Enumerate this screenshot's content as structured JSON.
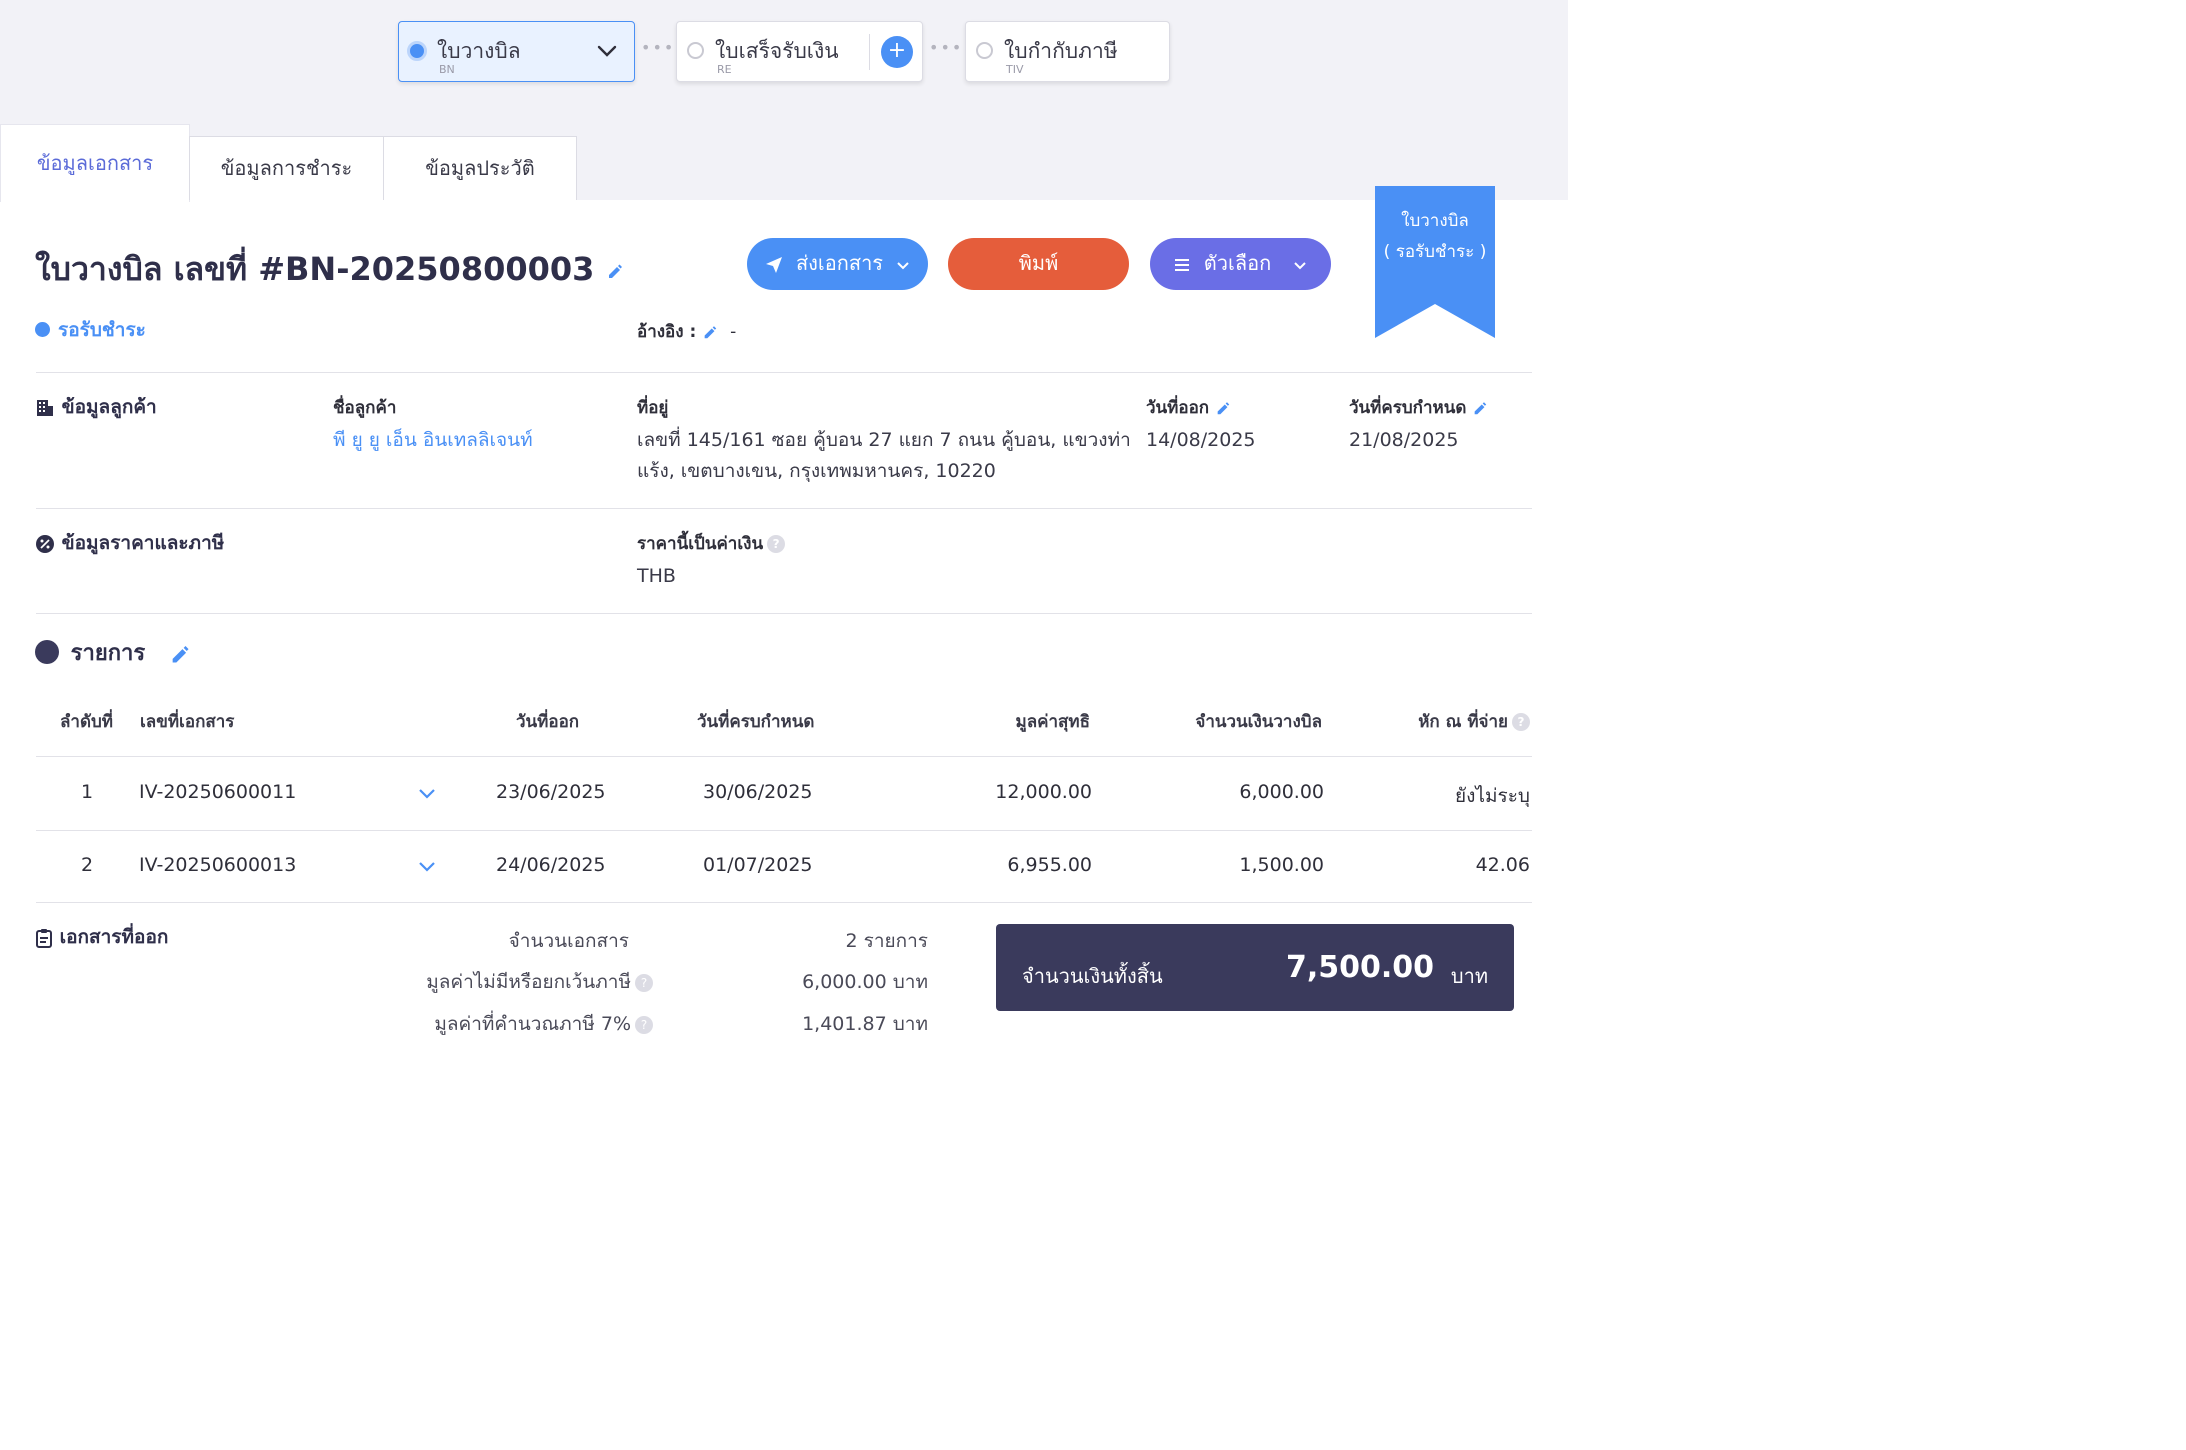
{
  "flow": {
    "billing": {
      "title": "ใบวางบิล",
      "code": "BN"
    },
    "receipt": {
      "title": "ใบเสร็จรับเงิน",
      "code": "RE"
    },
    "tax_invoice": {
      "title": "ใบกำกับภาษี",
      "code": "TIV"
    }
  },
  "tabs": [
    "ข้อมูลเอกสาร",
    "ข้อมูลการชำระ",
    "ข้อมูลประวัติ"
  ],
  "ribbon": {
    "line1": "ใบวางบิล",
    "line2": "( รอรับชำระ )"
  },
  "document": {
    "title": "ใบวางบิล เลขที่ #BN-20250800003",
    "status": "รอรับชำระ",
    "reference_label": "อ้างอิง :",
    "reference_value": "-"
  },
  "buttons": {
    "send": "ส่งเอกสาร",
    "print": "พิมพ์",
    "options": "ตัวเลือก"
  },
  "customer": {
    "section_label": "ข้อมูลลูกค้า",
    "name_label": "ชื่อลูกค้า",
    "name": "พี ยู ยู เอ็น อินเทลลิเจนท์",
    "address_label": "ที่อยู่",
    "address_line1": "เลขที่ 145/161 ซอย คู้บอน 27 แยก 7 ถนน คู้บอน, แขวงท่า",
    "address_line2": "แร้ง, เขตบางเขน, กรุงเทพมหานคร, 10220",
    "issue_date_label": "วันที่ออก",
    "issue_date": "14/08/2025",
    "due_date_label": "วันที่ครบกำหนด",
    "due_date": "21/08/2025"
  },
  "pricing": {
    "section_label": "ข้อมูลราคาและภาษี",
    "currency_label": "ราคานี้เป็นค่าเงิน",
    "currency": "THB"
  },
  "items": {
    "section_label": "รายการ",
    "headers": [
      "ลำดับที่",
      "เลขที่เอกสาร",
      "วันที่ออก",
      "วันที่ครบกำหนด",
      "มูลค่าสุทธิ",
      "จำนวนเงินวางบิล",
      "หัก ณ ที่จ่าย"
    ],
    "rows": [
      {
        "no": "1",
        "doc": "IV-20250600011",
        "issue": "23/06/2025",
        "due": "30/06/2025",
        "net": "12,000.00",
        "billed": "6,000.00",
        "wht": "ยังไม่ระบุ"
      },
      {
        "no": "2",
        "doc": "IV-20250600013",
        "issue": "24/06/2025",
        "due": "01/07/2025",
        "net": "6,955.00",
        "billed": "1,500.00",
        "wht": "42.06"
      }
    ]
  },
  "summary": {
    "section_label": "เอกสารที่ออก",
    "doc_count_label": "จำนวนเอกสาร",
    "doc_count": "2 รายการ",
    "non_vat_label": "มูลค่าไม่มีหรือยกเว้นภาษี",
    "non_vat": "6,000.00 บาท",
    "vat_label": "มูลค่าที่คำนวณภาษี 7%",
    "vat": "1,401.87 บาท",
    "total_label": "จำนวนเงินทั้งสิ้น",
    "total": "7,500.00",
    "total_unit": "บาท"
  },
  "colors": {
    "primary": "#4a90f5",
    "print": "#e55d3b",
    "options": "#6a6ee6",
    "total_bg": "#3a3a5c"
  }
}
